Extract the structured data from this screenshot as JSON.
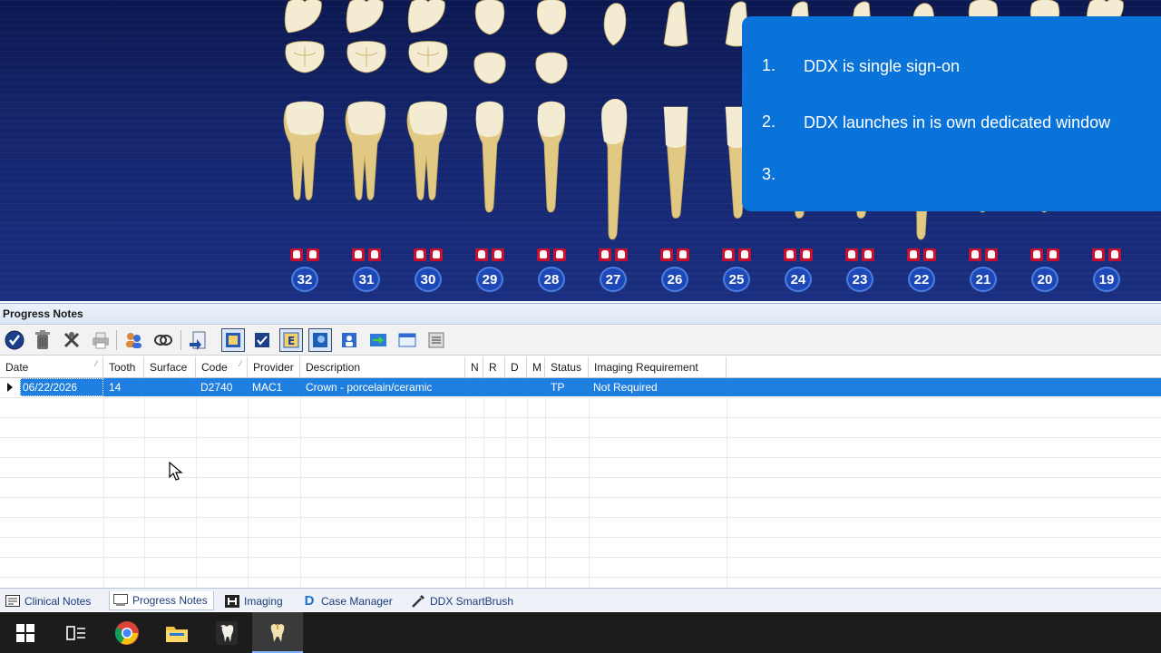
{
  "tooth_chart": {
    "teeth": [
      {
        "number": "32",
        "type": "molar"
      },
      {
        "number": "31",
        "type": "molar"
      },
      {
        "number": "30",
        "type": "molar"
      },
      {
        "number": "29",
        "type": "premolar"
      },
      {
        "number": "28",
        "type": "premolar"
      },
      {
        "number": "27",
        "type": "canine"
      },
      {
        "number": "26",
        "type": "incisor"
      },
      {
        "number": "25",
        "type": "incisor"
      },
      {
        "number": "24",
        "type": "incisor"
      },
      {
        "number": "23",
        "type": "incisor"
      },
      {
        "number": "22",
        "type": "canine"
      },
      {
        "number": "21",
        "type": "premolar"
      },
      {
        "number": "20",
        "type": "premolar"
      },
      {
        "number": "19",
        "type": "molar"
      }
    ]
  },
  "callout": {
    "items": [
      {
        "num": "1.",
        "text": "DDX is single sign-on"
      },
      {
        "num": "2.",
        "text": "DDX launches in is own dedicated window"
      },
      {
        "num": "3.",
        "text": ""
      }
    ]
  },
  "panel": {
    "title": "Progress Notes"
  },
  "toolbar": {
    "buttons": [
      "check-icon",
      "trash-icon",
      "tools-icon",
      "printer-icon",
      "users-icon",
      "chain-icon",
      "document-arrow-icon",
      "notes-icon",
      "check-doc-icon",
      "e-doc-icon",
      "image-doc-icon",
      "person-doc-icon",
      "transfer-icon",
      "window-icon",
      "list-icon"
    ]
  },
  "grid": {
    "columns": [
      "Date",
      "Tooth",
      "Surface",
      "Code",
      "Provider",
      "Description",
      "N",
      "R",
      "D",
      "M",
      "Status",
      "Imaging Requirement"
    ],
    "rows": [
      {
        "date": "06/22/2026",
        "tooth": "14",
        "surface": "",
        "code": "D2740",
        "provider": "MAC1",
        "description": "Crown - porcelain/ceramic",
        "n": "",
        "r": "",
        "d": "",
        "m": "",
        "status": "TP",
        "imaging": "Not Required"
      }
    ]
  },
  "tabs": [
    {
      "label": "Clinical Notes",
      "icon": "notes-grid-icon"
    },
    {
      "label": "Progress Notes",
      "icon": "progress-notes-icon",
      "active": true
    },
    {
      "label": "Imaging",
      "icon": "imaging-icon"
    },
    {
      "label": "Case Manager",
      "icon": "d-logo-icon"
    },
    {
      "label": "DDX SmartBrush",
      "icon": "brush-icon"
    }
  ],
  "taskbar": {
    "apps": [
      "windows-start-icon",
      "task-view-icon",
      "chrome-icon",
      "file-explorer-icon",
      "dental-app-icon",
      "dental-app-active-icon"
    ]
  },
  "colors": {
    "chart_bg": "#15266e",
    "callout_bg": "#0a73d9",
    "selection": "#1f7fe0",
    "taskbar": "#1c1c1c"
  }
}
